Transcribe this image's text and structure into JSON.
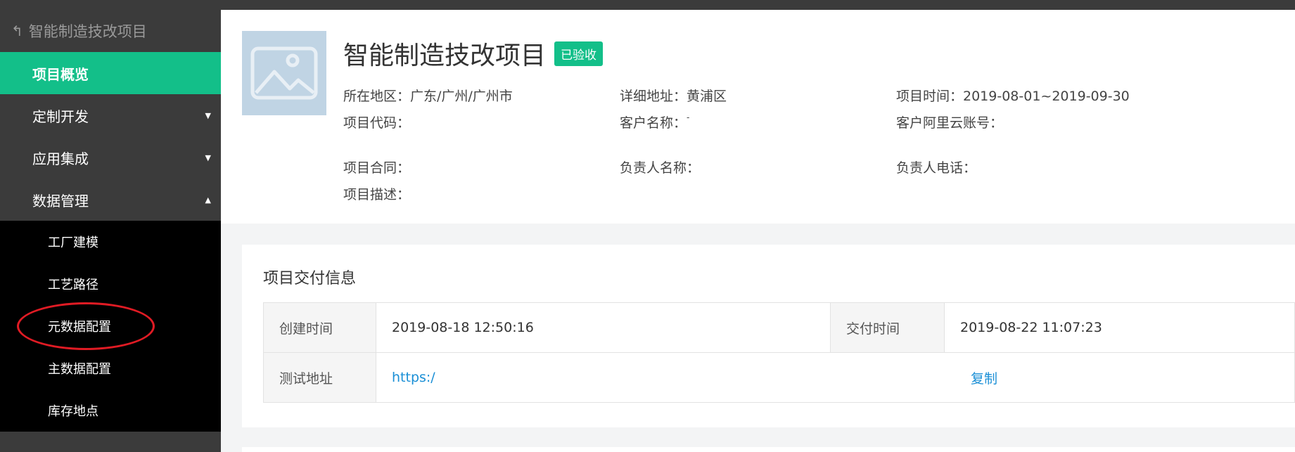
{
  "sidebar": {
    "back_label": "智能制造技改项目",
    "items": [
      {
        "label": "项目概览",
        "active": true
      },
      {
        "label": "定制开发",
        "expanded": false
      },
      {
        "label": "应用集成",
        "expanded": false
      },
      {
        "label": "数据管理",
        "expanded": true
      }
    ],
    "sub_items": [
      "工厂建模",
      "工艺路径",
      "元数据配置",
      "主数据配置",
      "库存地点"
    ],
    "highlighted_sub_item": "元数据配置"
  },
  "project": {
    "title": "智能制造技改项目",
    "status_badge": "已验收",
    "fields": {
      "region": "所在地区：广东/广州/广州市",
      "address": "详细地址：黄浦区",
      "time": "项目时间：2019-08-01~2019-09-30",
      "code": "项目代码：",
      "client": "客户名称：",
      "client_mark": "-",
      "aliyun": "客户阿里云账号：",
      "contract": "项目合同：",
      "owner": "负责人名称：",
      "phone": "负责人电话：",
      "desc": "项目描述："
    }
  },
  "delivery": {
    "section_title": "项目交付信息",
    "created_label": "创建时间",
    "created_value": "2019-08-18 12:50:16",
    "delivered_label": "交付时间",
    "delivered_value": "2019-08-22 11:07:23",
    "test_url_label": "测试地址",
    "test_url_value": "https:/",
    "copy_label": "复制"
  },
  "colors": {
    "accent": "#13bf89",
    "sidebar_bg": "#3b3b3b",
    "submenu_bg": "#000000",
    "link": "#1a8fd6",
    "annotation": "#e01b24"
  },
  "icons": [
    "back-arrow-icon",
    "caret-down-icon",
    "caret-up-icon",
    "image-placeholder-icon"
  ]
}
